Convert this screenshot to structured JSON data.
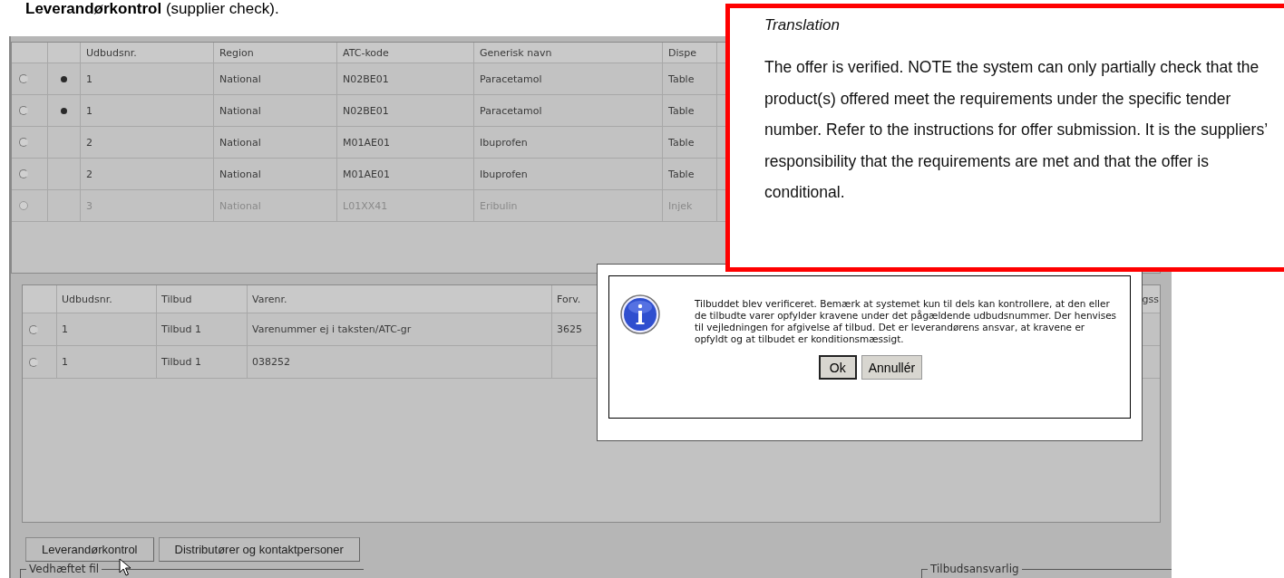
{
  "caption": "**Leverandørkontrol** (supplier check).",
  "offers_table": {
    "columns": [
      "Udbudsnr.",
      "Region",
      "ATC-kode",
      "Generisk navn",
      "Dispe"
    ],
    "rows": [
      {
        "selected": false,
        "marked": true,
        "disabled": false,
        "cells": [
          "1",
          "National",
          "N02BE01",
          "Paracetamol",
          "Table"
        ]
      },
      {
        "selected": false,
        "marked": true,
        "disabled": false,
        "cells": [
          "1",
          "National",
          "N02BE01",
          "Paracetamol",
          "Table"
        ]
      },
      {
        "selected": false,
        "marked": false,
        "disabled": false,
        "cells": [
          "2",
          "National",
          "M01AE01",
          "Ibuprofen",
          "Table"
        ]
      },
      {
        "selected": false,
        "marked": false,
        "disabled": false,
        "cells": [
          "2",
          "National",
          "M01AE01",
          "Ibuprofen",
          "Table"
        ]
      },
      {
        "selected": false,
        "marked": false,
        "disabled": true,
        "cells": [
          "3",
          "National",
          "L01XX41",
          "Eribulin",
          "Injek"
        ]
      }
    ]
  },
  "lines_table": {
    "columns": [
      "Udbudsnr.",
      "Tilbud",
      "Varenr.",
      "Forv.",
      "gss"
    ],
    "rows": [
      {
        "selected": false,
        "cells": [
          "1",
          "Tilbud 1",
          "Varenummer ej i taksten/ATC-gr",
          "3625"
        ]
      },
      {
        "selected": false,
        "cells": [
          "1",
          "Tilbud 1",
          "038252"
        ]
      }
    ]
  },
  "buttons": [
    "Leverandørkontrol",
    "Distributører og kontaktpersoner"
  ],
  "fieldsets": [
    "Vedhæftet fil",
    "Tilbudsansvarlig"
  ],
  "dialog": {
    "message": "Tilbuddet blev verificeret. Bemærk at systemet kun til dels kan kontrollere, at den eller de tilbudte varer opfylder kravene under det pågældende udbudsnummer. Der henvises til vejledningen for afgivelse af tilbud. Det er leverandørens ansvar, at kravene er opfyldt og at tilbudet er konditionsmæssigt.",
    "buttons": [
      {
        "label": "Ok",
        "default": true
      },
      {
        "label": "Annullér",
        "default": false
      }
    ]
  },
  "translation": {
    "title": "Translation",
    "body": "The offer is verified. NOTE the system can only partially check that the product(s) offered meet the requirements under the specific tender number. Refer to the instructions for offer submission. It is the suppliers’ responsibility that the requirements are met and that the offer is conditional."
  }
}
